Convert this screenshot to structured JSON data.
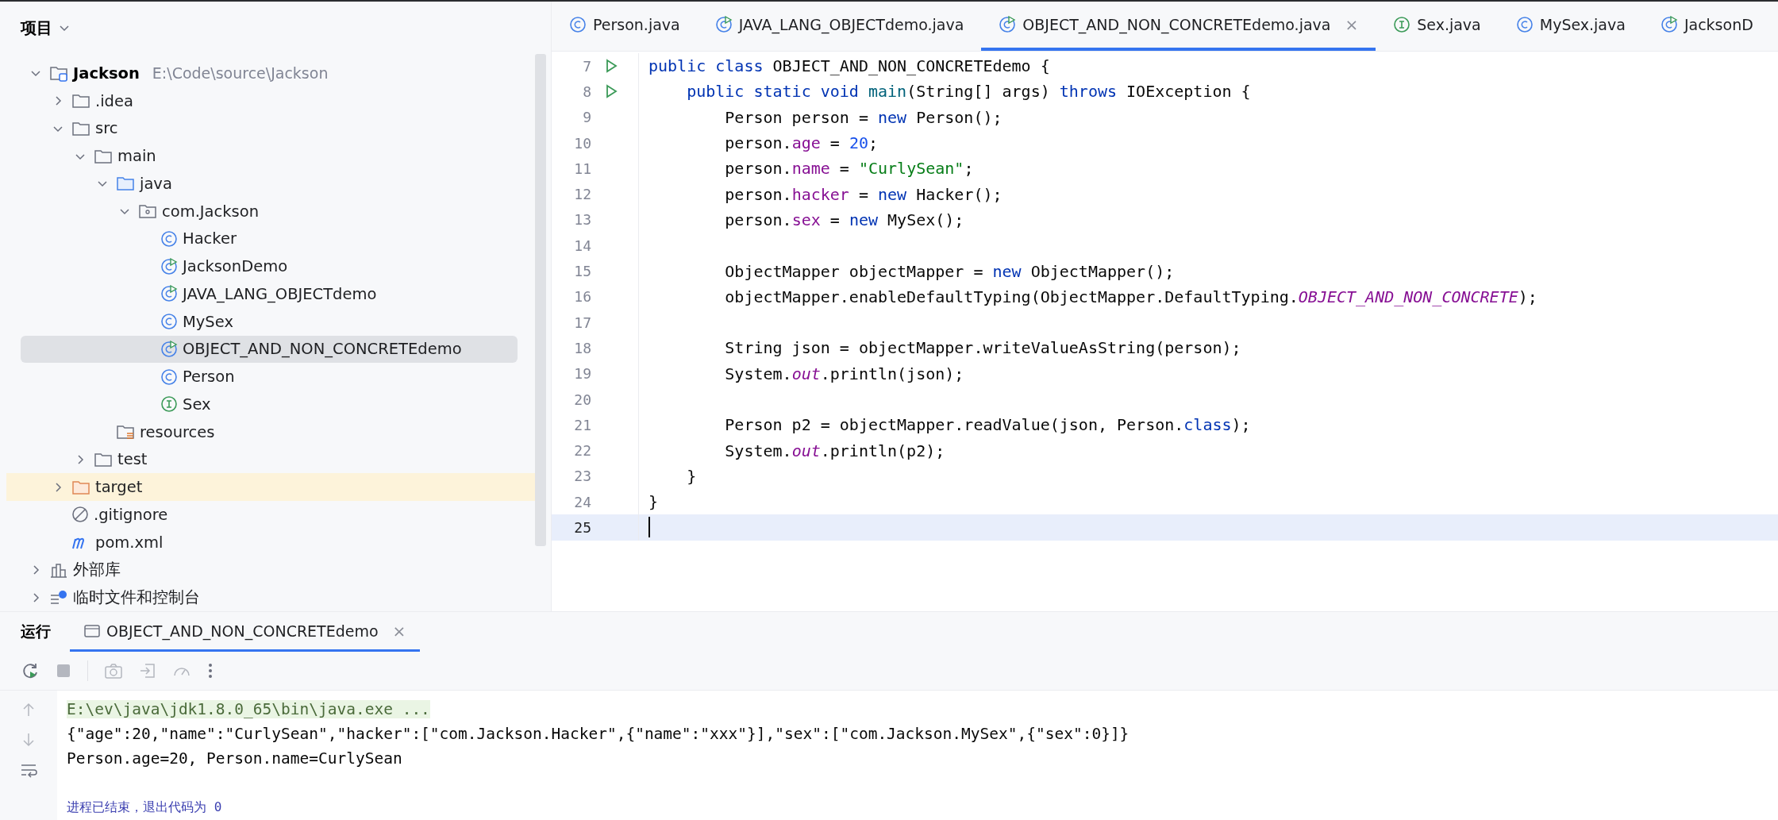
{
  "project_panel": {
    "title": "项目",
    "tree": [
      {
        "label": "Jackson",
        "detail": "E:\\Code\\source\\Jackson",
        "kind": "module",
        "expanded": true,
        "selected": false,
        "highlighted": false,
        "children": [
          {
            "label": ".idea",
            "kind": "folder",
            "expanded": false,
            "selected": false,
            "highlighted": false
          },
          {
            "label": "src",
            "kind": "folder",
            "expanded": true,
            "selected": false,
            "highlighted": false,
            "children": [
              {
                "label": "main",
                "kind": "folder",
                "expanded": true,
                "selected": false,
                "highlighted": false,
                "children": [
                  {
                    "label": "java",
                    "kind": "source-folder",
                    "expanded": true,
                    "selected": false,
                    "highlighted": false,
                    "children": [
                      {
                        "label": "com.Jackson",
                        "kind": "package",
                        "expanded": true,
                        "selected": false,
                        "highlighted": false,
                        "children": [
                          {
                            "label": "Hacker",
                            "kind": "class",
                            "selected": false,
                            "highlighted": false
                          },
                          {
                            "label": "JacksonDemo",
                            "kind": "class-run",
                            "selected": false,
                            "highlighted": false
                          },
                          {
                            "label": "JAVA_LANG_OBJECTdemo",
                            "kind": "class-run",
                            "selected": false,
                            "highlighted": false
                          },
                          {
                            "label": "MySex",
                            "kind": "class",
                            "selected": false,
                            "highlighted": false
                          },
                          {
                            "label": "OBJECT_AND_NON_CONCRETEdemo",
                            "kind": "class-run",
                            "selected": true,
                            "highlighted": false
                          },
                          {
                            "label": "Person",
                            "kind": "class",
                            "selected": false,
                            "highlighted": false
                          },
                          {
                            "label": "Sex",
                            "kind": "interface",
                            "selected": false,
                            "highlighted": false
                          }
                        ]
                      }
                    ]
                  },
                  {
                    "label": "resources",
                    "kind": "resources",
                    "selected": false,
                    "highlighted": false
                  }
                ]
              },
              {
                "label": "test",
                "kind": "folder",
                "expanded": false,
                "selected": false,
                "highlighted": false
              }
            ]
          },
          {
            "label": "target",
            "kind": "excluded-folder",
            "expanded": false,
            "selected": false,
            "highlighted": true
          },
          {
            "label": ".gitignore",
            "kind": "ignore",
            "selected": false,
            "highlighted": false
          },
          {
            "label": "pom.xml",
            "kind": "maven",
            "selected": false,
            "highlighted": false
          }
        ]
      },
      {
        "label": "外部库",
        "kind": "library",
        "expanded": false,
        "selected": false,
        "highlighted": false
      },
      {
        "label": "临时文件和控制台",
        "kind": "scratch",
        "expanded": false,
        "selected": false,
        "highlighted": false
      }
    ]
  },
  "editor_tabs": [
    {
      "label": "Person.java",
      "kind": "class",
      "selected": false
    },
    {
      "label": "JAVA_LANG_OBJECTdemo.java",
      "kind": "class-run",
      "selected": false
    },
    {
      "label": "OBJECT_AND_NON_CONCRETEdemo.java",
      "kind": "class-run",
      "selected": true,
      "close": "×"
    },
    {
      "label": "Sex.java",
      "kind": "interface",
      "selected": false
    },
    {
      "label": "MySex.java",
      "kind": "class",
      "selected": false
    },
    {
      "label": "JacksonD",
      "kind": "class-run",
      "selected": false
    }
  ],
  "code": [
    {
      "number": "7",
      "run": true,
      "current": false,
      "tokens": [
        {
          "kind": "keyword",
          "t": "public class "
        },
        {
          "kind": "plain",
          "t": "OBJECT_AND_NON_CONCRETEdemo {"
        }
      ]
    },
    {
      "number": "8",
      "run": true,
      "current": false,
      "tokens": [
        {
          "kind": "keyword",
          "t": "    public static void "
        },
        {
          "kind": "method",
          "t": "main"
        },
        {
          "kind": "plain",
          "t": "(String[] args) "
        },
        {
          "kind": "keyword",
          "t": "throws "
        },
        {
          "kind": "plain",
          "t": "IOException {"
        }
      ]
    },
    {
      "number": "9",
      "run": false,
      "current": false,
      "tokens": [
        {
          "kind": "plain",
          "t": "        Person person = "
        },
        {
          "kind": "keyword",
          "t": "new "
        },
        {
          "kind": "plain",
          "t": "Person();"
        }
      ]
    },
    {
      "number": "10",
      "run": false,
      "current": false,
      "tokens": [
        {
          "kind": "plain",
          "t": "        person."
        },
        {
          "kind": "field",
          "t": "age"
        },
        {
          "kind": "plain",
          "t": " = "
        },
        {
          "kind": "number",
          "t": "20"
        },
        {
          "kind": "plain",
          "t": ";"
        }
      ]
    },
    {
      "number": "11",
      "run": false,
      "current": false,
      "tokens": [
        {
          "kind": "plain",
          "t": "        person."
        },
        {
          "kind": "field",
          "t": "name"
        },
        {
          "kind": "plain",
          "t": " = "
        },
        {
          "kind": "string",
          "t": "\"CurlySean\""
        },
        {
          "kind": "plain",
          "t": ";"
        }
      ]
    },
    {
      "number": "12",
      "run": false,
      "current": false,
      "tokens": [
        {
          "kind": "plain",
          "t": "        person."
        },
        {
          "kind": "field",
          "t": "hacker"
        },
        {
          "kind": "plain",
          "t": " = "
        },
        {
          "kind": "keyword",
          "t": "new "
        },
        {
          "kind": "plain",
          "t": "Hacker();"
        }
      ]
    },
    {
      "number": "13",
      "run": false,
      "current": false,
      "tokens": [
        {
          "kind": "plain",
          "t": "        person."
        },
        {
          "kind": "field",
          "t": "sex"
        },
        {
          "kind": "plain",
          "t": " = "
        },
        {
          "kind": "keyword",
          "t": "new "
        },
        {
          "kind": "plain",
          "t": "MySex();"
        }
      ]
    },
    {
      "number": "14",
      "run": false,
      "current": false
    },
    {
      "number": "15",
      "run": false,
      "current": false,
      "tokens": [
        {
          "kind": "plain",
          "t": "        ObjectMapper objectMapper = "
        },
        {
          "kind": "keyword",
          "t": "new "
        },
        {
          "kind": "plain",
          "t": "ObjectMapper();"
        }
      ]
    },
    {
      "number": "16",
      "run": false,
      "current": false,
      "tokens": [
        {
          "kind": "plain",
          "t": "        objectMapper.enableDefaultTyping(ObjectMapper.DefaultTyping."
        },
        {
          "kind": "static",
          "t": "OBJECT_AND_NON_CONCRETE"
        },
        {
          "kind": "plain",
          "t": ");"
        }
      ]
    },
    {
      "number": "17",
      "run": false,
      "current": false
    },
    {
      "number": "18",
      "run": false,
      "current": false,
      "tokens": [
        {
          "kind": "plain",
          "t": "        String json = objectMapper.writeValueAsString(person);"
        }
      ]
    },
    {
      "number": "19",
      "run": false,
      "current": false,
      "tokens": [
        {
          "kind": "plain",
          "t": "        System."
        },
        {
          "kind": "static",
          "t": "out"
        },
        {
          "kind": "plain",
          "t": ".println(json);"
        }
      ]
    },
    {
      "number": "20",
      "run": false,
      "current": false
    },
    {
      "number": "21",
      "run": false,
      "current": false,
      "tokens": [
        {
          "kind": "plain",
          "t": "        Person p2 = objectMapper.readValue(json, Person."
        },
        {
          "kind": "keyword",
          "t": "class"
        },
        {
          "kind": "plain",
          "t": ");"
        }
      ]
    },
    {
      "number": "22",
      "run": false,
      "current": false,
      "tokens": [
        {
          "kind": "plain",
          "t": "        System."
        },
        {
          "kind": "static",
          "t": "out"
        },
        {
          "kind": "plain",
          "t": ".println(p2);"
        }
      ]
    },
    {
      "number": "23",
      "run": false,
      "current": false,
      "tokens": [
        {
          "kind": "plain",
          "t": "    }"
        }
      ]
    },
    {
      "number": "24",
      "run": false,
      "current": false,
      "tokens": [
        {
          "kind": "plain",
          "t": "}"
        }
      ]
    },
    {
      "number": "25",
      "run": false,
      "current": true
    }
  ],
  "run_panel": {
    "title": "运行",
    "tabs": [
      {
        "label": "OBJECT_AND_NON_CONCRETEdemo",
        "selected": true,
        "close": "×"
      }
    ],
    "console": [
      {
        "kind": "command",
        "text": "E:\\ev\\java\\jdk1.8.0_65\\bin\\java.exe ..."
      },
      {
        "kind": "output",
        "text": "{\"age\":20,\"name\":\"CurlySean\",\"hacker\":[\"com.Jackson.Hacker\",{\"name\":\"xxx\"}],\"sex\":[\"com.Jackson.MySex\",{\"sex\":0}]}"
      },
      {
        "kind": "output",
        "text": "Person.age=20, Person.name=CurlySean"
      },
      {
        "kind": "status",
        "text": "进程已结束，退出代码为 0"
      }
    ]
  }
}
